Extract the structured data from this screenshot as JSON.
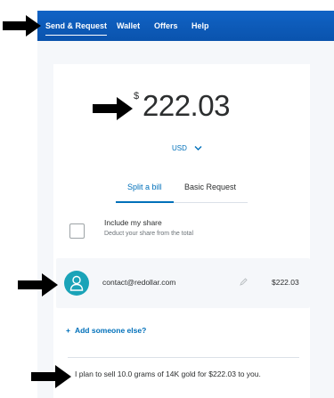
{
  "nav": {
    "items": [
      {
        "label": "Send & Request",
        "active": true
      },
      {
        "label": "Wallet",
        "active": false
      },
      {
        "label": "Offers",
        "active": false
      },
      {
        "label": "Help",
        "active": false
      }
    ]
  },
  "amount": {
    "symbol": "$",
    "value": "222.03"
  },
  "currency": {
    "selected": "USD",
    "icon": "chevron-down-icon"
  },
  "tabs": {
    "split": "Split a bill",
    "basic": "Basic Request",
    "active": "split"
  },
  "share": {
    "title": "Include my share",
    "subtitle": "Deduct your share from the total",
    "checked": false
  },
  "recipient": {
    "email": "contact@redollar.com",
    "amount": "$222.03",
    "avatar_icon": "person-icon",
    "edit_icon": "pencil-icon"
  },
  "add": {
    "icon": "plus-icon",
    "label": "Add someone else?"
  },
  "note": {
    "text": "I plan to sell 10.0 grams of 14K gold for $222.03 to you."
  },
  "colors": {
    "nav_bg": "#0b57b8",
    "accent": "#0070ba",
    "avatar": "#1aa3b8",
    "page_bg": "#f5f7fa",
    "text": "#2c2e2f",
    "annotation_arrow": "#000000"
  }
}
